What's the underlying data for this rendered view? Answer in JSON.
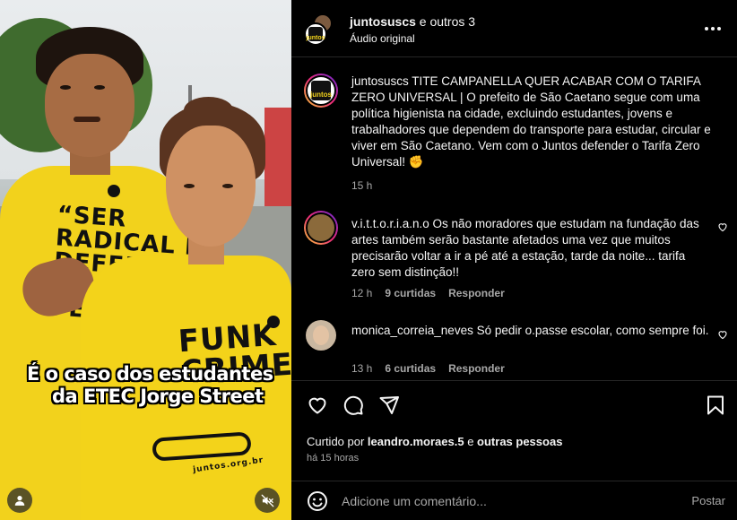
{
  "media": {
    "overlay_caption_line1": "É o caso dos estudantes",
    "overlay_caption_line2": "da ETEC Jorge Street",
    "shirt_text_1": "“SER\nRADICAL É\nDEFENDER\nAS COISAS\nPELA RAIZ",
    "shirt_text_2": "FUNK\nCRIME",
    "shirt_text_2_small": "juntos.org.br"
  },
  "header": {
    "author": "juntosuscs",
    "coauthors": " e outros 3",
    "audio": "Áudio original",
    "more_icon": "more-horizontal-icon"
  },
  "post": {
    "username": "juntosuscs",
    "caption": " TITE CAMPANELLA QUER ACABAR COM O TARIFA ZERO UNIVERSAL | O prefeito de São Caetano segue com uma política higienista na cidade, excluindo estudantes, jovens e trabalhadores que dependem do transporte para estudar, circular e viver em São Caetano. Vem com o Juntos defender o Tarifa Zero Universal! ✊",
    "time": "15 h"
  },
  "comments": [
    {
      "username": "v.i.t.t.o.r.i.a.n.o",
      "text": " Os não moradores que estudam na fundação das artes também serão bastante afetados uma vez que muitos precisarão voltar a ir a pé até a estação, tarde da noite... tarifa zero sem distinção!!",
      "time": "12 h",
      "likes": "9 curtidas",
      "reply": "Responder"
    },
    {
      "username": "monica_correia_neves",
      "text": " Só pedir o.passe escolar, como sempre foi.",
      "time": "13 h",
      "likes": "6 curtidas",
      "reply": "Responder"
    }
  ],
  "actions": {
    "liked_by_prefix": "Curtido por ",
    "liked_by_user": "leandro.moraes.5",
    "liked_by_suffix": " e ",
    "liked_by_others": "outras pessoas",
    "posted_ago": "há 15 horas"
  },
  "comment_box": {
    "placeholder": "Adicione um comentário...",
    "post_label": "Postar"
  },
  "logo_text": "juntos"
}
